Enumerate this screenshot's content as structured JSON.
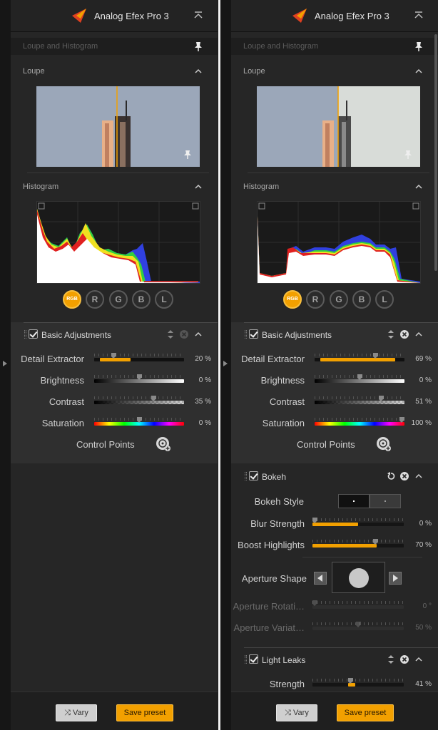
{
  "app": {
    "title": "Analog Efex Pro 3"
  },
  "loupe_histogram": {
    "title": "Loupe and Histogram"
  },
  "loupe": {
    "label": "Loupe"
  },
  "histogram": {
    "label": "Histogram",
    "channels": [
      "RGB",
      "R",
      "G",
      "B",
      "L"
    ],
    "active_channel": "RGB"
  },
  "colors": {
    "accent": "#f2a000",
    "panel_bg": "#262626",
    "module_bg": "#2f2f2f"
  },
  "left_panel": {
    "basic": {
      "title": "Basic Adjustments",
      "rows": [
        {
          "label": "Detail Extractor",
          "value": "20 %",
          "level": 0.2
        },
        {
          "label": "Brightness",
          "value": "0 %",
          "level": 0.5
        },
        {
          "label": "Contrast",
          "value": "35 %",
          "level": 0.675
        },
        {
          "label": "Saturation",
          "value": "0 %",
          "level": 0.5
        }
      ],
      "control_points": "Control Points"
    }
  },
  "right_panel": {
    "basic": {
      "title": "Basic Adjustments",
      "rows": [
        {
          "label": "Detail Extractor",
          "value": "69 %",
          "level": 0.69
        },
        {
          "label": "Brightness",
          "value": "0 %",
          "level": 0.5
        },
        {
          "label": "Contrast",
          "value": "51 %",
          "level": 0.755
        },
        {
          "label": "Saturation",
          "value": "100 %",
          "level": 1.0
        }
      ],
      "control_points": "Control Points"
    },
    "bokeh": {
      "title": "Bokeh",
      "style_label": "Bokeh Style",
      "blur_strength": {
        "label": "Blur Strength",
        "value": "0 %",
        "level": 0.0
      },
      "boost_highlights": {
        "label": "Boost Highlights",
        "value": "70 %",
        "level": 0.7
      },
      "aperture_shape": "Aperture Shape",
      "aperture_rotation": {
        "label": "Aperture Rotati…",
        "value": "0 °",
        "level": 0.0
      },
      "aperture_variation": {
        "label": "Aperture Variat…",
        "value": "50 %",
        "level": 0.5
      }
    },
    "light_leaks": {
      "title": "Light Leaks",
      "strength": {
        "label": "Strength",
        "value": "41 %",
        "level": 0.41
      }
    }
  },
  "footer": {
    "vary": "Vary",
    "save_preset": "Save preset"
  }
}
